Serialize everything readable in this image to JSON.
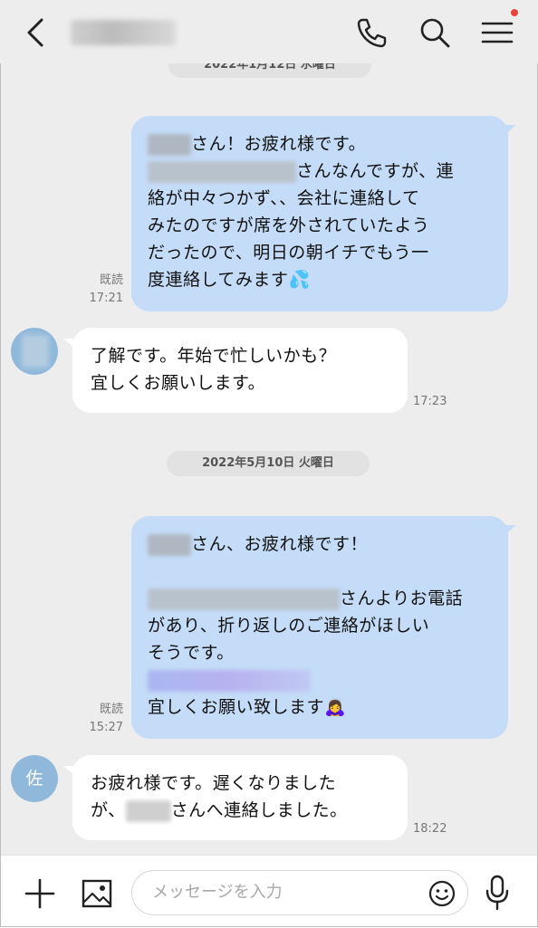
{
  "header": {
    "icons": [
      "back-icon",
      "phone-icon",
      "search-icon",
      "menu-icon"
    ],
    "notification_color": "#e8463a"
  },
  "date_top_partial": "2022年1月12日 水曜日",
  "messages": [
    {
      "side": "me",
      "lines": [
        "さん！お疲れ様です。",
        "さんなんですが、連",
        "絡が中々つかず、、会社に連絡して",
        "みたのですが席を外されていたよう",
        "だったので、明日の朝イチでもう一",
        "度連絡してみます"
      ],
      "emoji": "💦",
      "read": "既読",
      "time": "17:21"
    },
    {
      "side": "them",
      "lines": [
        "了解です。年始で忙しいかも？",
        "宜しくお願いします。"
      ],
      "time": "17:23"
    },
    {
      "side": "me",
      "lines": [
        "さん、お疲れ様です！",
        "さんよりお電話",
        "があり、折り返しのご連絡がほしい",
        "そうです。",
        "宜しくお願い致します"
      ],
      "emoji": "🙇‍♀️",
      "read": "既読",
      "time": "15:27"
    },
    {
      "side": "them",
      "avatar": "佐",
      "lines": [
        "お疲れ様です。遅くなりました",
        "が、",
        "さんへ連絡しました。"
      ],
      "time": "18:22"
    }
  ],
  "date_divider": "2022年5月10日 火曜日",
  "input": {
    "placeholder": "メッセージを入力"
  },
  "colors": {
    "bubble_me": "#c5dcf8",
    "bubble_them": "#ffffff",
    "background": "#ededed"
  }
}
